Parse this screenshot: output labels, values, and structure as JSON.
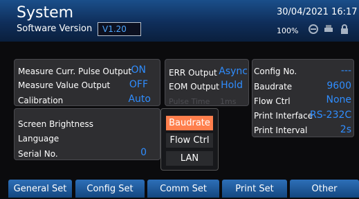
{
  "header": {
    "title": "System",
    "software_version_label": "Software Version",
    "software_version_value": "V1.20",
    "datetime": "30/04/2021 16:17",
    "battery": "100%",
    "icons": [
      "usb-icon",
      "printer-icon",
      "lock-icon"
    ]
  },
  "measure_panel": {
    "rows": [
      {
        "label": "Measure Curr. Pulse Output",
        "value": "ON"
      },
      {
        "label": "Measure Value Output",
        "value": "OFF"
      },
      {
        "label": "Calibration",
        "value": "Auto"
      }
    ]
  },
  "output_panel": {
    "rows": [
      {
        "label": "ERR Output",
        "value": "Async"
      },
      {
        "label": "EOM Output",
        "value": "Hold"
      }
    ],
    "pulse_time_label": "Pulse Time",
    "pulse_time_value": "1ms"
  },
  "config_panel": {
    "rows": [
      {
        "label": "Config No.",
        "value": "---"
      },
      {
        "label": "Baudrate",
        "value": "9600"
      },
      {
        "label": "Flow Ctrl",
        "value": "None"
      },
      {
        "label": "Print Interface",
        "value": "RS-232C"
      },
      {
        "label": "Print Interval",
        "value": "2s"
      }
    ]
  },
  "display_panel": {
    "rows": [
      {
        "label": "Screen Brightness",
        "value": ""
      },
      {
        "label": "Language",
        "value": ""
      },
      {
        "label": "Serial No.",
        "value": "0"
      }
    ]
  },
  "popup": {
    "items": [
      "Baudrate",
      "Flow Ctrl",
      "LAN"
    ],
    "selected": "Baudrate"
  },
  "tabs": [
    "General Set",
    "Config Set",
    "Comm Set",
    "Print Set",
    "Other"
  ],
  "colors": {
    "value_blue": "#2f8dff",
    "highlight": "#ff7f4d"
  }
}
